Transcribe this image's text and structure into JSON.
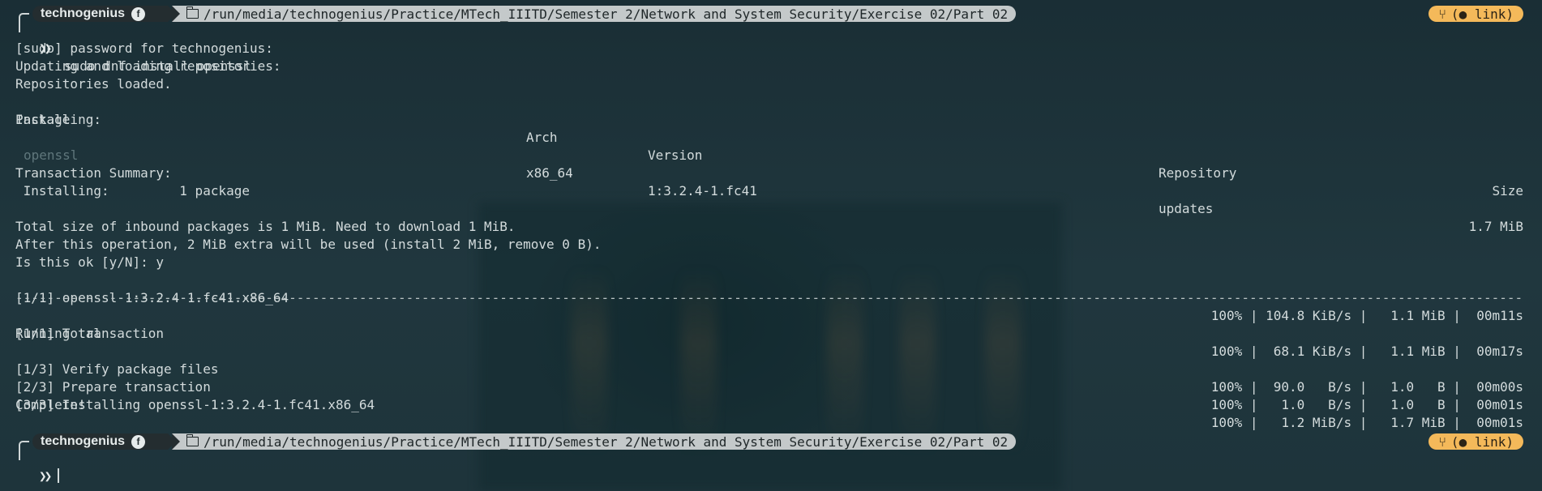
{
  "prompt": {
    "user": "technogenius",
    "os_icon": "fedora-icon",
    "path": "/run/media/technogenius/Practice/MTech_IIITD/Semester 2/Network and System Security/Exercise 02/Part 02",
    "git_symbol": "ᵾ",
    "git_label": "( link)",
    "chevron": "❯❯"
  },
  "command": "sudo dnf install openssl",
  "output": {
    "password_prompt": "[sudo] password for technogenius:",
    "updating": "Updating and loading repositories:",
    "loaded": "Repositories loaded.",
    "table_headers": {
      "package": "Package",
      "arch": "Arch",
      "version": "Version",
      "repository": "Repository",
      "size": "Size"
    },
    "installing_header": "Installing:",
    "package_row": {
      "name": "openssl",
      "arch": "x86_64",
      "version": "1:3.2.4-1.fc41",
      "repository": "updates",
      "size": "1.7 MiB"
    },
    "summary_title": "Transaction Summary:",
    "summary_installing": " Installing:         1 package",
    "total_size": "Total size of inbound packages is 1 MiB. Need to download 1 MiB.",
    "after_op": "After this operation, 2 MiB extra will be used (install 2 MiB, remove 0 B).",
    "confirm": "Is this ok [y/N]: y",
    "download": {
      "label": "[1/1] openssl-1:3.2.4-1.fc41.x86_64",
      "stats": "100% | 104.8 KiB/s |   1.1 MiB |  00m11s"
    },
    "separator_char": "-",
    "total": {
      "label": "[1/1] Total",
      "stats": "100% |  68.1 KiB/s |   1.1 MiB |  00m17s"
    },
    "running": "Running transaction",
    "steps": [
      {
        "label": "[1/3] Verify package files",
        "stats": "100% |  90.0   B/s |   1.0   B |  00m00s"
      },
      {
        "label": "[2/3] Prepare transaction",
        "stats": "100% |   1.0   B/s |   1.0   B |  00m01s"
      },
      {
        "label": "[3/3] Installing openssl-1:3.2.4-1.fc41.x86_64",
        "stats": "100% |   1.2 MiB/s |   1.7 MiB |  00m01s"
      }
    ],
    "complete": "Complete!"
  },
  "colors": {
    "background": "#1c3138",
    "text": "#d3dbdc",
    "dim_text": "#5f767b",
    "user_segment": "#242d30",
    "path_segment": "#c4c9ca",
    "git_segment": "#f4b95a"
  }
}
